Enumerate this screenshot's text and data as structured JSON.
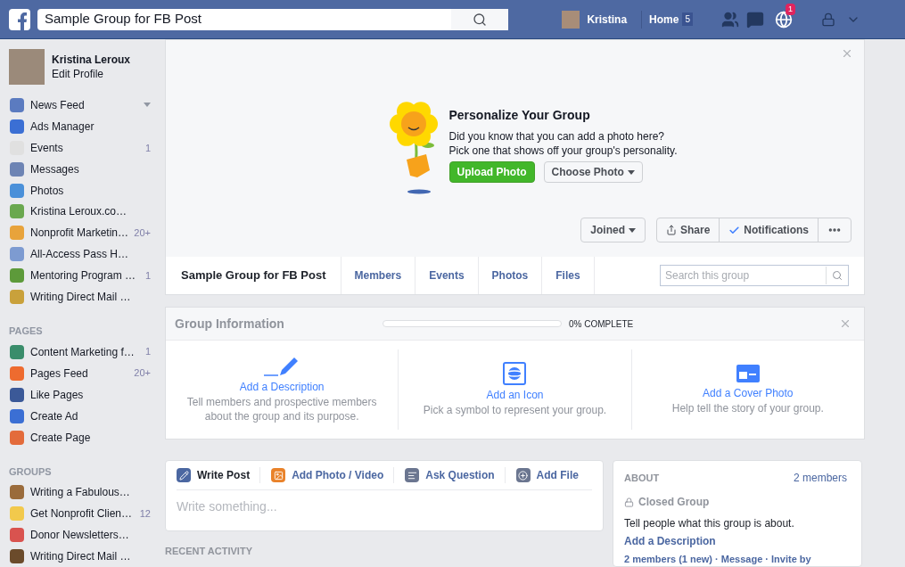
{
  "top_bar": {
    "search_value": "Sample Group for FB Post",
    "user": "Kristina",
    "home": "Home",
    "home_count": "5",
    "notification_count": "1"
  },
  "sidebar": {
    "profile": {
      "name": "Kristina Leroux",
      "edit": "Edit Profile"
    },
    "favorites": [
      {
        "label": "News Feed",
        "menu": true
      },
      {
        "label": "Ads Manager",
        "menu": false
      },
      {
        "label": "Events",
        "count": "1",
        "menu": false
      },
      {
        "label": "Messages",
        "menu": false
      },
      {
        "label": "Photos",
        "menu": false
      },
      {
        "label": "Kristina Leroux.co…",
        "menu": false
      },
      {
        "label": "Nonprofit Marketin…",
        "count": "20+",
        "menu": false
      },
      {
        "label": "All-Access Pass H…",
        "menu": false
      },
      {
        "label": "Mentoring Program …",
        "count": "1",
        "menu": false
      },
      {
        "label": "Writing Direct Mail …",
        "menu": false
      }
    ],
    "sections": [
      {
        "heading": "PAGES",
        "items": [
          {
            "label": "Content Marketing f…",
            "count": "1"
          },
          {
            "label": "Pages Feed",
            "count": "20+"
          },
          {
            "label": "Like Pages"
          },
          {
            "label": "Create Ad"
          },
          {
            "label": "Create Page"
          }
        ]
      },
      {
        "heading": "GROUPS",
        "items": [
          {
            "label": "Writing a Fabulous…"
          },
          {
            "label": "Get Nonprofit Clien…",
            "count": "12"
          },
          {
            "label": "Donor Newsletters…"
          },
          {
            "label": "Writing Direct Mail …"
          }
        ]
      }
    ]
  },
  "cover": {
    "title": "Personalize Your Group",
    "text": [
      "Did you know that you can add a photo here?",
      "Pick one that shows off your group's personality."
    ],
    "upload": "Upload Photo",
    "choose": "Choose Photo",
    "joined": "Joined",
    "share": "Share",
    "notifications": "Notifications",
    "notifications_on": true
  },
  "group_nav": {
    "tabs": [
      {
        "label": "Sample Group for FB Post",
        "selected": true
      },
      {
        "label": "Members",
        "selected": false
      },
      {
        "label": "Events",
        "selected": false
      },
      {
        "label": "Photos",
        "selected": false
      },
      {
        "label": "Files",
        "selected": false
      }
    ],
    "search": {
      "placeholder": "Search this group"
    }
  },
  "group_info": {
    "title": "Group Information",
    "level": 0,
    "reading": "0% COMPLETE",
    "cards": [
      {
        "kind": "description",
        "title": "Add a Description",
        "text": "Tell members and prospective members about the group and its purpose."
      },
      {
        "kind": "icon",
        "title": "Add an Icon",
        "text": "Pick a symbol to represent your group."
      },
      {
        "kind": "cover",
        "title": "Add a Cover Photo",
        "text": "Help tell the story of your group."
      }
    ]
  },
  "composer": {
    "tabs": [
      {
        "kind": "write",
        "label": "Write Post",
        "selected": true
      },
      {
        "kind": "photo",
        "label": "Add Photo / Video",
        "selected": false
      },
      {
        "kind": "question",
        "label": "Ask Question",
        "selected": false
      },
      {
        "kind": "file",
        "label": "Add File",
        "selected": false
      }
    ],
    "placeholder": "Write something..."
  },
  "recent_activity": "RECENT ACTIVITY",
  "about": {
    "heading": "ABOUT",
    "members": "2 members",
    "privacy": "Closed Group",
    "text": "Tell people what this group is about.",
    "link": "Add a Description",
    "footer": "2 members (1 new) · Message · Invite by"
  }
}
